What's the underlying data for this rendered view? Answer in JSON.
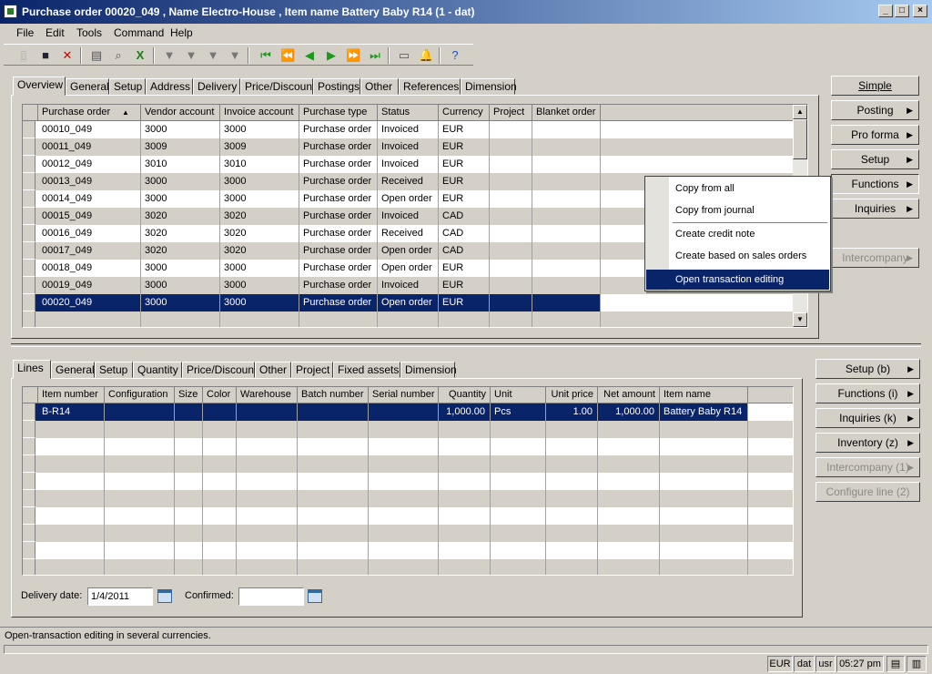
{
  "window": {
    "title": "Purchase order 00020_049 , Name Electro-House , Item name Battery Baby R14 (1 - dat)"
  },
  "menu": [
    "File",
    "Edit",
    "Tools",
    "Command",
    "Help"
  ],
  "top_tabs": [
    "Overview",
    "General",
    "Setup",
    "Address",
    "Delivery",
    "Price/Discount",
    "Postings",
    "Other",
    "References",
    "Dimension"
  ],
  "orders": {
    "columns": [
      "Purchase order",
      "Vendor account",
      "Invoice account",
      "Purchase type",
      "Status",
      "Currency",
      "Project",
      "Blanket order"
    ],
    "rows": [
      [
        "00010_049",
        "3000",
        "3000",
        "Purchase order",
        "Invoiced",
        "EUR"
      ],
      [
        "00011_049",
        "3009",
        "3009",
        "Purchase order",
        "Invoiced",
        "EUR"
      ],
      [
        "00012_049",
        "3010",
        "3010",
        "Purchase order",
        "Invoiced",
        "EUR"
      ],
      [
        "00013_049",
        "3000",
        "3000",
        "Purchase order",
        "Received",
        "EUR"
      ],
      [
        "00014_049",
        "3000",
        "3000",
        "Purchase order",
        "Open order",
        "EUR"
      ],
      [
        "00015_049",
        "3020",
        "3020",
        "Purchase order",
        "Invoiced",
        "CAD"
      ],
      [
        "00016_049",
        "3020",
        "3020",
        "Purchase order",
        "Received",
        "CAD"
      ],
      [
        "00017_049",
        "3020",
        "3020",
        "Purchase order",
        "Open order",
        "CAD"
      ],
      [
        "00018_049",
        "3000",
        "3000",
        "Purchase order",
        "Open order",
        "EUR"
      ],
      [
        "00019_049",
        "3000",
        "3000",
        "Purchase order",
        "Invoiced",
        "EUR"
      ],
      [
        "00020_049",
        "3000",
        "3000",
        "Purchase order",
        "Open order",
        "EUR"
      ]
    ]
  },
  "right_buttons": {
    "simple": "Simple",
    "posting": "Posting",
    "pro_forma": "Pro forma",
    "setup": "Setup",
    "functions": "Functions",
    "inquiries": "Inquiries",
    "intercompany": "Intercompany"
  },
  "context_menu": [
    "Copy from all",
    "Copy from journal",
    "Create credit note",
    "Create based on sales orders",
    "Open transaction editing"
  ],
  "line_tabs": [
    "Lines",
    "General",
    "Setup",
    "Quantity",
    "Price/Discount",
    "Other",
    "Project",
    "Fixed assets",
    "Dimension"
  ],
  "lines": {
    "columns": [
      "Item number",
      "Configuration",
      "Size",
      "Color",
      "Warehouse",
      "Batch number",
      "Serial number",
      "Quantity",
      "Unit",
      "Unit price",
      "Net amount",
      "Item name"
    ],
    "rows": [
      [
        "B-R14",
        "",
        "",
        "",
        "",
        "",
        "",
        "1,000.00",
        "Pcs",
        "1.00",
        "1,000.00",
        "Battery Baby R14"
      ]
    ]
  },
  "line_buttons": {
    "setup": "Setup (b)",
    "functions": "Functions (i)",
    "inquiries": "Inquiries (k)",
    "inventory": "Inventory (z)",
    "intercompany": "Intercompany (1)",
    "configure": "Configure line (2)"
  },
  "delivery": {
    "label": "Delivery date:",
    "value": "1/4/2011"
  },
  "confirmed": {
    "label": "Confirmed:",
    "value": ""
  },
  "status_text": "Open-transaction editing in several currencies.",
  "status_bar": {
    "currency": "EUR",
    "company": "dat",
    "user": "usr",
    "time": "05:27 pm"
  }
}
